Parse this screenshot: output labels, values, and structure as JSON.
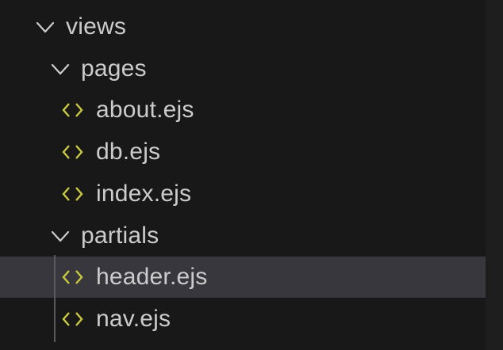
{
  "explorer": {
    "folder_views": {
      "label": "views"
    },
    "folder_pages": {
      "label": "pages"
    },
    "pages_files": [
      {
        "label": "about.ejs"
      },
      {
        "label": "db.ejs"
      },
      {
        "label": "index.ejs"
      }
    ],
    "folder_partials": {
      "label": "partials"
    },
    "partials_files": [
      {
        "label": "header.ejs",
        "selected": true
      },
      {
        "label": "nav.ejs",
        "selected": false
      }
    ]
  },
  "colors": {
    "background": "#181818",
    "selected_row": "#37373d",
    "text": "#cccccc",
    "ejs_icon": "#cbcb41",
    "indent_guide": "#585858"
  },
  "icons": {
    "folder_toggle": "chevron-down-icon",
    "file": "ejs-file-icon"
  }
}
